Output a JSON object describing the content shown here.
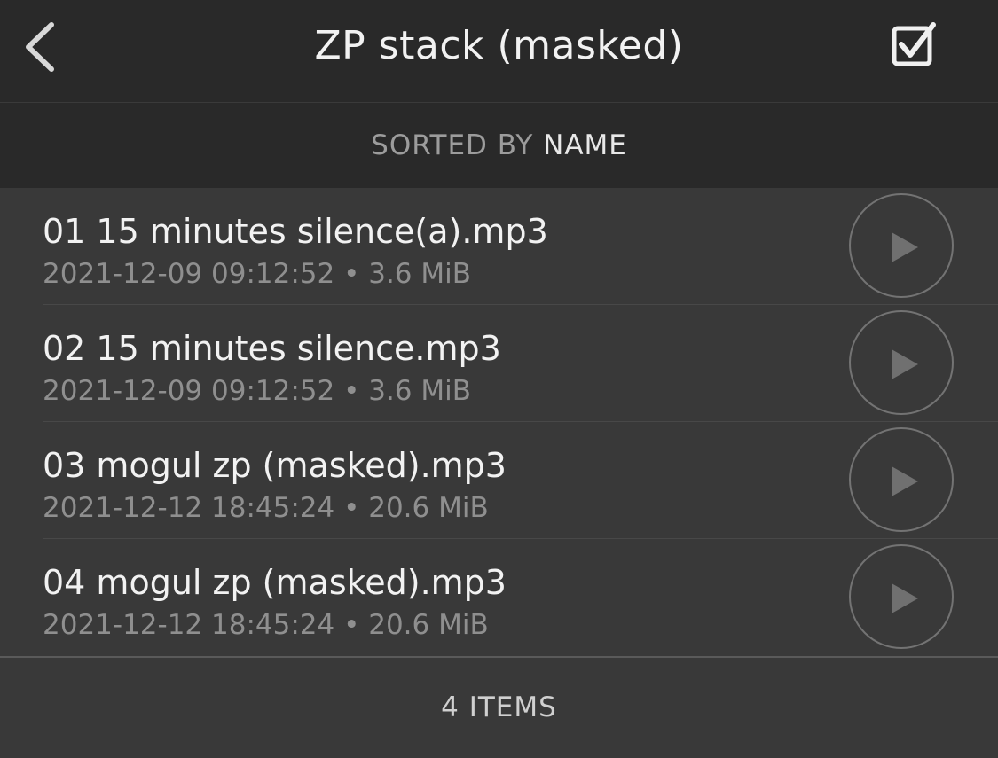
{
  "header": {
    "title": "ZP stack (masked)",
    "back_icon": "chevron-left-icon",
    "select_icon": "checkbox-checked-icon"
  },
  "sortbar": {
    "label": "SORTED BY",
    "value": "NAME"
  },
  "files": [
    {
      "name": "01 15 minutes silence(a).mp3",
      "meta": "2021-12-09 09:12:52 • 3.6 MiB"
    },
    {
      "name": "02 15 minutes silence.mp3",
      "meta": "2021-12-09 09:12:52 • 3.6 MiB"
    },
    {
      "name": "03 mogul zp (masked).mp3",
      "meta": "2021-12-12 18:45:24 • 20.6 MiB"
    },
    {
      "name": "04 mogul zp (masked).mp3",
      "meta": "2021-12-12 18:45:24 • 20.6 MiB"
    }
  ],
  "footer": {
    "count_label": "4 ITEMS"
  },
  "colors": {
    "header_bg": "#292929",
    "list_bg": "#393939",
    "text_primary": "#f2f2f2",
    "text_secondary": "#8f8f8f"
  }
}
